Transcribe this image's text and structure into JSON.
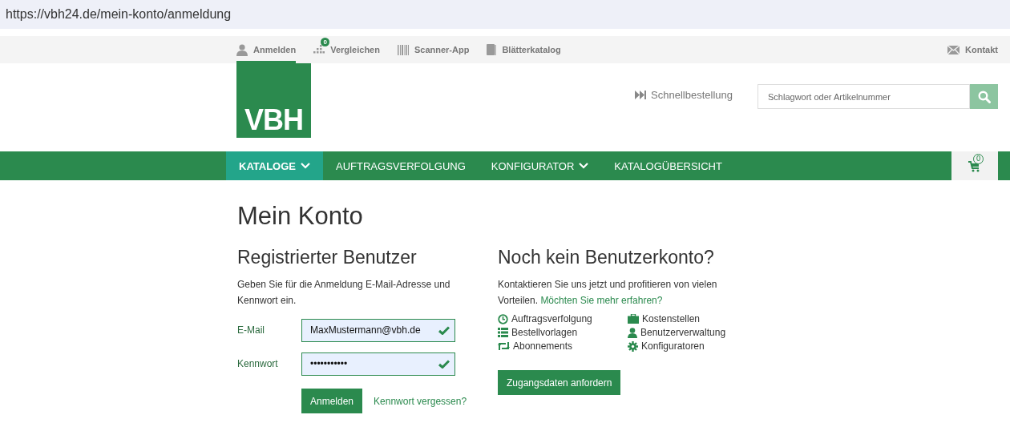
{
  "address_bar": {
    "url": "https://vbh24.de/mein-konto/anmeldung"
  },
  "top_bar": {
    "links": [
      {
        "label": "Anmelden",
        "selected": true
      },
      {
        "label": "Vergleichen",
        "badge": "0",
        "selected": false
      },
      {
        "label": "Scanner-App",
        "selected": false
      },
      {
        "label": "Blätterkatalog",
        "selected": false
      }
    ],
    "contact": "Kontakt"
  },
  "header": {
    "logo": "VBH",
    "quick_order": "Schnellbestellung",
    "search": {
      "placeholder": "Schlagwort oder Artikelnummer"
    }
  },
  "nav": {
    "items": [
      {
        "label": "KATALOGE",
        "dropdown": true,
        "selected": true
      },
      {
        "label": "AUFTRAGSVERFOLGUNG",
        "dropdown": false,
        "selected": false
      },
      {
        "label": "KONFIGURATOR",
        "dropdown": true,
        "selected": false
      },
      {
        "label": "KATALOGÜBERSICHT",
        "dropdown": false,
        "selected": false
      }
    ],
    "cart_count": "0"
  },
  "page_title": "Mein Konto",
  "login": {
    "heading": "Registrierter Benutzer",
    "intro": "Geben Sie für die Anmeldung E-Mail-Adresse und Kennwort ein.",
    "fields": [
      {
        "label": "E-Mail",
        "value": "MaxMustermann@vbh.de",
        "valid": true
      },
      {
        "label": "Kennwort",
        "value": "•••••••••••",
        "valid": true
      }
    ],
    "submit": "Anmelden",
    "forgot_link": "Kennwort vergessen?"
  },
  "register": {
    "heading": "Noch kein Benutzerkonto?",
    "intro": "Kontaktieren Sie uns jetzt und profitieren von vielen Vorteilen.",
    "more_link": "Möchten Sie mehr erfahren?",
    "features": [
      "Auftragsverfolgung",
      "Kostenstellen",
      "Bestellvorlagen",
      "Benutzerverwaltung",
      "Abonnements",
      "Konfiguratoren"
    ],
    "button": "Zugangsdaten anfordern"
  }
}
